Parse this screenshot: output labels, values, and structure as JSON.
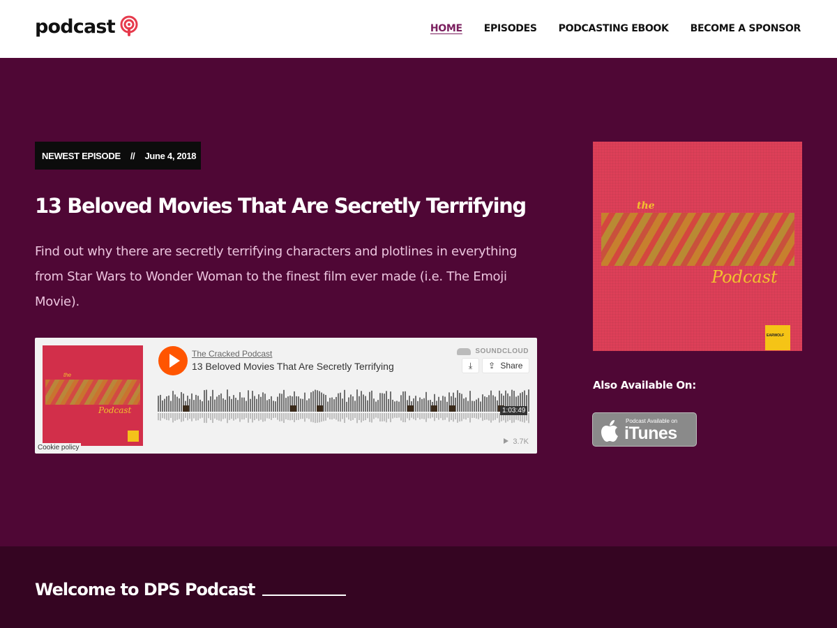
{
  "header": {
    "logo_text": "podcast",
    "nav": [
      {
        "label": "HOME",
        "active": true
      },
      {
        "label": "EPISODES",
        "active": false
      },
      {
        "label": "PODCASTING EBOOK",
        "active": false
      },
      {
        "label": "BECOME A SPONSOR",
        "active": false
      }
    ]
  },
  "hero": {
    "badge_label": "NEWEST EPISODE",
    "badge_sep": "//",
    "badge_date": "June 4, 2018",
    "title": "13 Beloved Movies That Are Secretly Terrifying",
    "description": "Find out why there are secretly terrifying characters and plotlines in everything from Star Wars to Wonder Woman to the finest film ever made (i.e. The Emoji Movie)."
  },
  "player": {
    "user": "The Cracked Podcast",
    "track": "13 Beloved Movies That Are Secretly Terrifying",
    "brand": "SOUNDCLOUD",
    "download_icon": "⤓",
    "share_label": "Share",
    "share_icon": "⇪",
    "duration": "1:03:49",
    "plays": "3.7K",
    "cookie": "Cookie policy",
    "art_the": "the",
    "art_podcast": "Podcast"
  },
  "cover": {
    "the": "the",
    "podcast": "Podcast",
    "earwolf": "EARWOLF"
  },
  "sidebar": {
    "also_available": "Also Available On:",
    "itunes_small": "Podcast Available on",
    "itunes_big": "iTunes",
    "apple_icon": ""
  },
  "welcome": {
    "title": "Welcome to DPS Podcast"
  },
  "colors": {
    "hero_bg": "#4f0735",
    "welcome_bg": "#350522",
    "accent": "#7a1e5e",
    "soundcloud_orange": "#ff5500"
  }
}
